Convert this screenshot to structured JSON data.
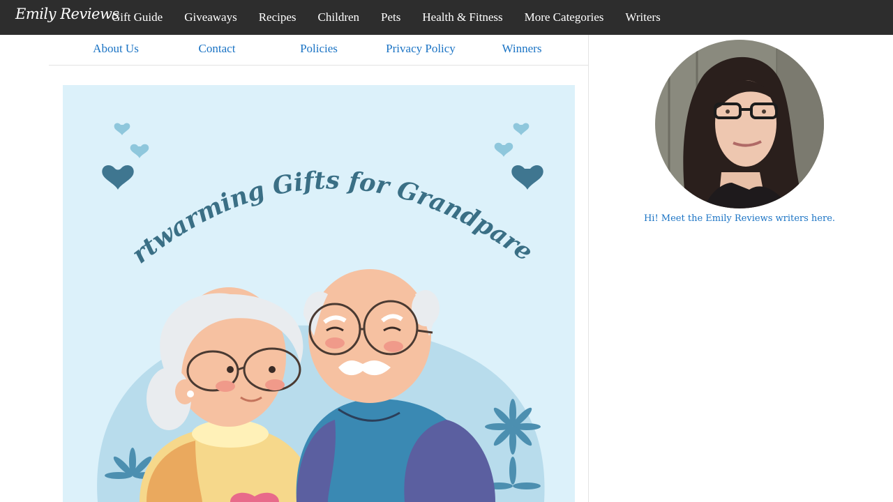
{
  "site": {
    "logo_text": "Emily Reviews"
  },
  "main_nav": [
    "Gift Guide",
    "Giveaways",
    "Recipes",
    "Children",
    "Pets",
    "Health & Fitness",
    "More Categories",
    "Writers"
  ],
  "sub_nav": [
    "About Us",
    "Contact",
    "Policies",
    "Privacy Policy",
    "Winners"
  ],
  "hero": {
    "title": "Heartwarming Gifts for Grandparents"
  },
  "sidebar": {
    "meet_link": "Hi! Meet the Emily Reviews writers here."
  },
  "colors": {
    "topbar_bg": "#2d2d2d",
    "link_blue": "#1a73c4",
    "hero_bg": "#dcf1fa",
    "hero_title": "#3a6f85"
  }
}
